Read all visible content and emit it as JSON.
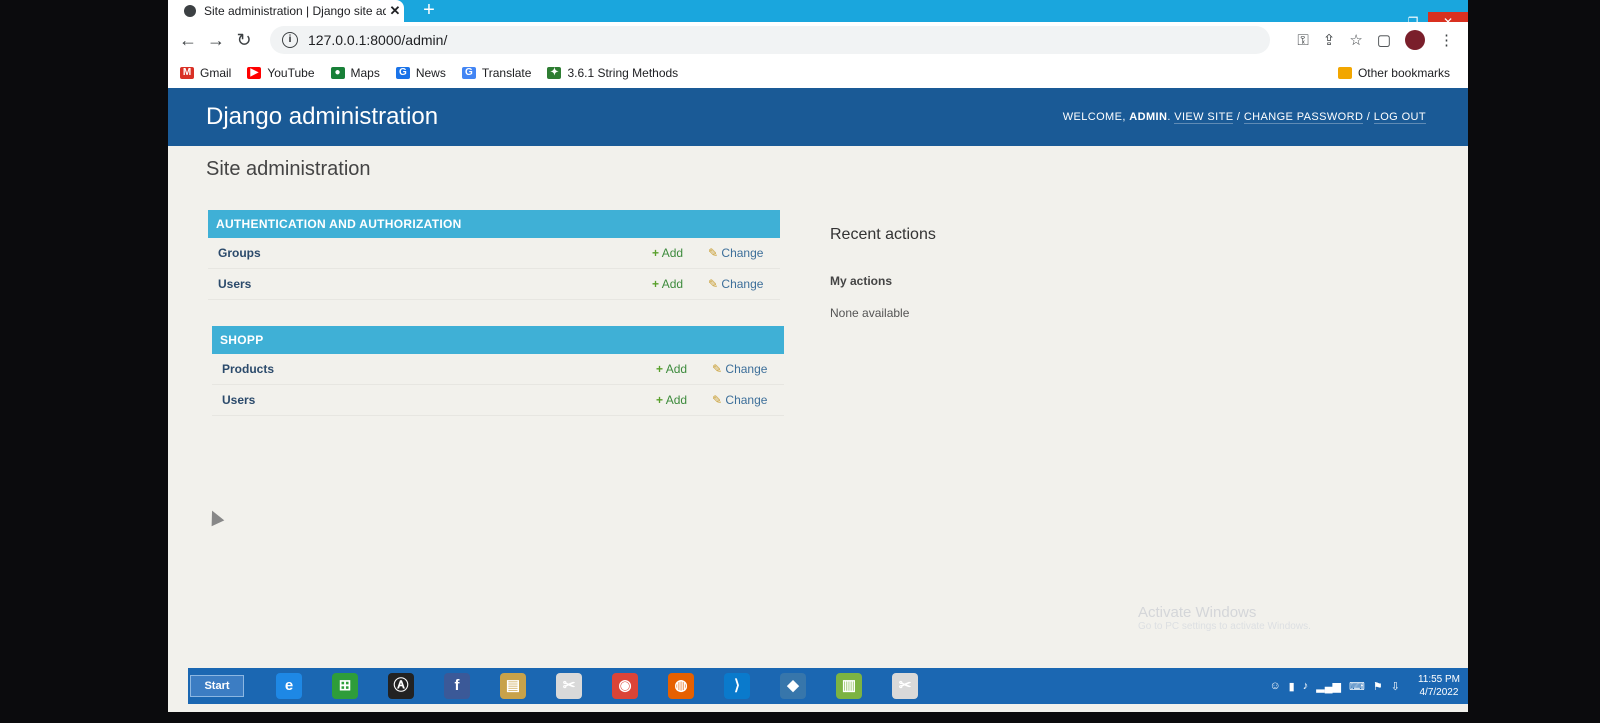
{
  "browser": {
    "tab_title": "Site administration | Django site admin",
    "tab_close": "✕",
    "new_tab": "+",
    "url": "127.0.0.1:8000/admin/",
    "window_controls": {
      "minimize": "–",
      "restore": "❐",
      "close": "✕"
    },
    "bookmarks": [
      {
        "label": "Gmail",
        "icon": "gmail-icon",
        "color": "#d93025",
        "glyph": "M"
      },
      {
        "label": "YouTube",
        "icon": "youtube-icon",
        "color": "#ff0000",
        "glyph": "▶"
      },
      {
        "label": "Maps",
        "icon": "maps-icon",
        "color": "#188038",
        "glyph": "●"
      },
      {
        "label": "News",
        "icon": "news-icon",
        "color": "#1a73e8",
        "glyph": "G"
      },
      {
        "label": "Translate",
        "icon": "translate-icon",
        "color": "#4285f4",
        "glyph": "G"
      },
      {
        "label": "3.6.1 String Methods",
        "icon": "page-icon",
        "color": "#2e7d32",
        "glyph": "✦"
      }
    ],
    "other_bookmarks": "Other bookmarks"
  },
  "django": {
    "branding": "Django administration",
    "user_tools": {
      "welcome": "Welcome,",
      "username": "admin",
      "view_site": "View site",
      "change_password": "Change password",
      "log_out": "Log out"
    },
    "page_title": "Site administration",
    "modules": [
      {
        "caption": "Authentication and Authorization",
        "models": [
          {
            "name": "Groups",
            "add": "Add",
            "change": "Change"
          },
          {
            "name": "Users",
            "add": "Add",
            "change": "Change"
          }
        ]
      },
      {
        "caption": "Shopp",
        "models": [
          {
            "name": "Products",
            "add": "Add",
            "change": "Change"
          },
          {
            "name": "Users",
            "add": "Add",
            "change": "Change"
          }
        ]
      }
    ],
    "recent_actions": {
      "title": "Recent actions",
      "my_actions": "My actions",
      "empty": "None available"
    }
  },
  "watermark": {
    "title": "Activate Windows",
    "subtitle": "Go to PC settings to activate Windows."
  },
  "taskbar": {
    "start": "Start",
    "apps": [
      {
        "icon": "internet-explorer-icon",
        "glyph": "e",
        "color": "#1e88e5"
      },
      {
        "icon": "store-icon",
        "glyph": "⊞",
        "color": "#2e9d3a"
      },
      {
        "icon": "arch-app-icon",
        "glyph": "Ⓐ",
        "color": "#222222"
      },
      {
        "icon": "facebook-icon",
        "glyph": "f",
        "color": "#3b5998"
      },
      {
        "icon": "file-explorer-icon",
        "glyph": "▤",
        "color": "#c8a24a"
      },
      {
        "icon": "snipping-icon",
        "glyph": "✂",
        "color": "#d9d9d9"
      },
      {
        "icon": "chrome-icon",
        "glyph": "◉",
        "color": "#db4437"
      },
      {
        "icon": "firefox-icon",
        "glyph": "◍",
        "color": "#e66000"
      },
      {
        "icon": "vscode-icon",
        "glyph": "⟩",
        "color": "#0a7acc"
      },
      {
        "icon": "python-icon",
        "glyph": "◆",
        "color": "#3776ab"
      },
      {
        "icon": "notepad-icon",
        "glyph": "▥",
        "color": "#7cb342"
      },
      {
        "icon": "snipping-icon-2",
        "glyph": "✂",
        "color": "#d9d9d9"
      }
    ],
    "time": "11:55 PM",
    "date": "4/7/2022"
  }
}
